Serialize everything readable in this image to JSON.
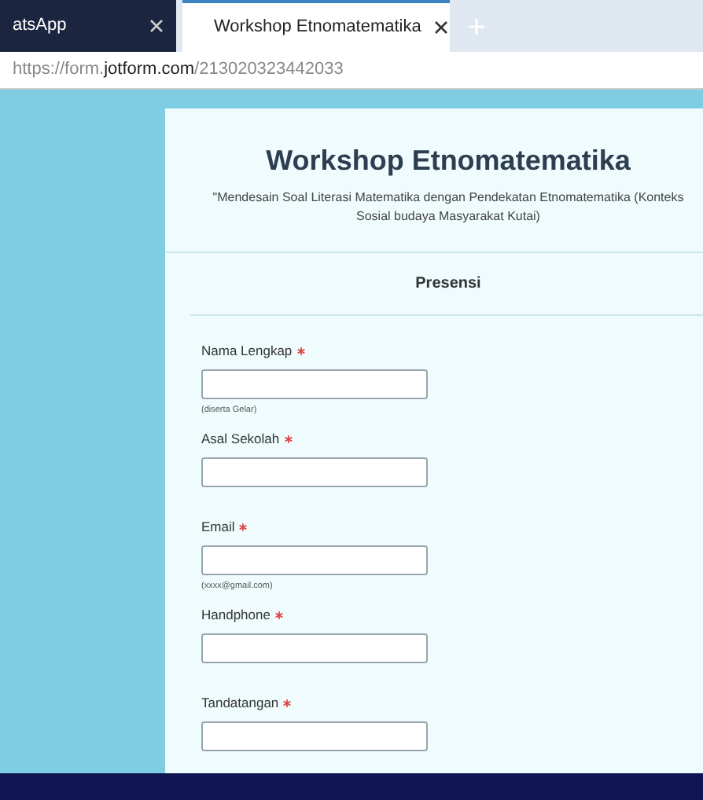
{
  "tabs": [
    {
      "label": "atsApp",
      "selected": false
    },
    {
      "label": "Workshop Etnomatematika",
      "selected": true
    }
  ],
  "address_bar": {
    "prefix": "https://form.",
    "domain": "jotform.com",
    "path": "/213020323442033"
  },
  "form": {
    "title": "Workshop Etnomatematika",
    "subtitle": "\"Mendesain Soal Literasi Matematika dengan Pendekatan Etnomatematika (Konteks Sosial budaya Masyarakat Kutai)",
    "section": "Presensi",
    "fields": [
      {
        "label": "Nama Lengkap",
        "required": true,
        "hint": "(diserta Gelar)"
      },
      {
        "label": "Asal Sekolah",
        "required": true
      },
      {
        "label": "Email",
        "required": true,
        "hint": "(xxxx@gmail.com)"
      },
      {
        "label": "Handphone",
        "required": true
      },
      {
        "label": "Tandatangan",
        "required": true
      }
    ]
  }
}
